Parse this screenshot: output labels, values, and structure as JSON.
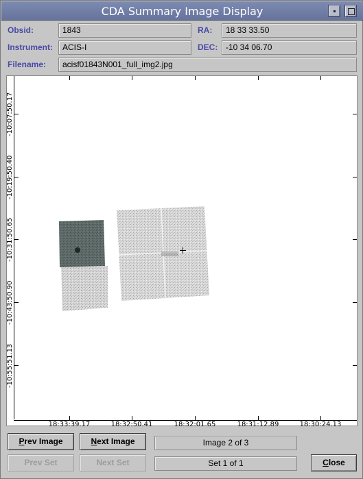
{
  "window": {
    "title": "CDA Summary Image Display",
    "minimize_icon": "minimize-icon",
    "maximize_icon": "maximize-icon"
  },
  "fields": {
    "obsid": {
      "label": "Obsid:",
      "value": "1843"
    },
    "ra": {
      "label": "RA:",
      "value": "18 33 33.50"
    },
    "instrument": {
      "label": "Instrument:",
      "value": "ACIS-I"
    },
    "dec": {
      "label": "DEC:",
      "value": "-10 34 06.70"
    },
    "filename": {
      "label": "Filename:",
      "value": "acisf01843N001_full_img2.jpg"
    }
  },
  "image": {
    "x_tick_labels": [
      "18:33:39.17",
      "18:32:50.41",
      "18:32:01.65",
      "18:31:12.89",
      "18:30:24.13"
    ],
    "y_tick_labels": [
      "-10:07:50.17",
      "-10:19:50.40",
      "-10:31:50.65",
      "-10:43:50.90",
      "-10:55:51.13"
    ],
    "crosshair_icon": "crosshair-icon"
  },
  "buttons": {
    "prev_image": {
      "label": "Prev Image",
      "mnemonic": "P",
      "rest": "rev Image",
      "enabled": true
    },
    "next_image": {
      "label": "Next Image",
      "mnemonic": "N",
      "rest": "ext Image",
      "enabled": true
    },
    "prev_set": {
      "label": "Prev Set",
      "enabled": false
    },
    "next_set": {
      "label": "Next Set",
      "enabled": false
    },
    "close": {
      "label": "Close",
      "mnemonic": "C",
      "rest": "lose",
      "enabled": true
    }
  },
  "status": {
    "image_counter": "Image 2 of 3",
    "set_counter": "Set 1 of 1"
  }
}
